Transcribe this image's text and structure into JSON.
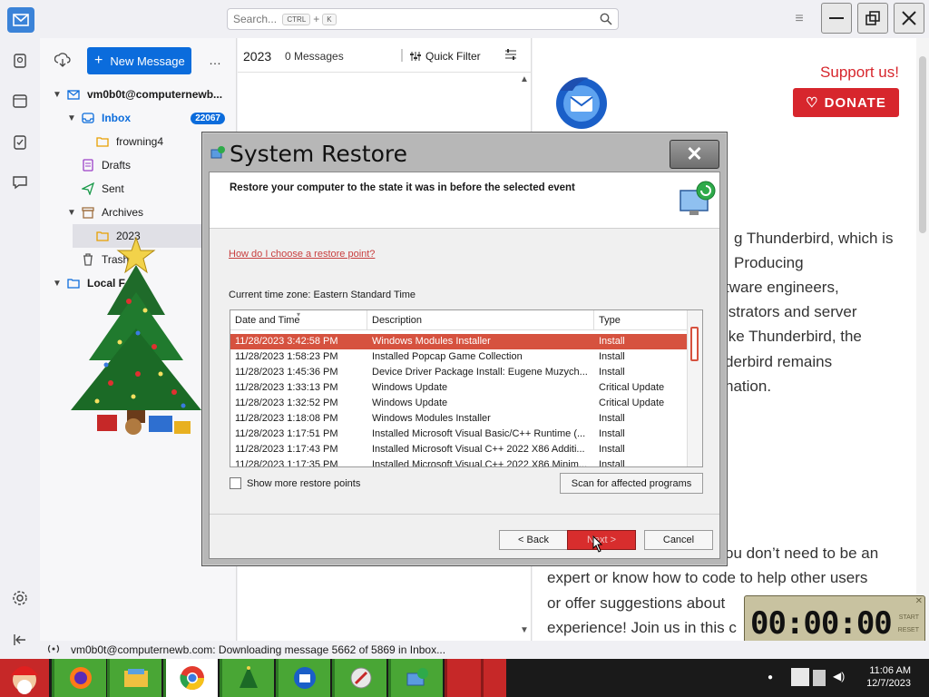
{
  "search": {
    "placeholder": "Search...",
    "key1": "CTRL",
    "plus": "+",
    "key2": "K"
  },
  "folderpane": {
    "new_message": "New Message",
    "more": "…",
    "account": "vm0b0t@computernewb...",
    "inbox": "Inbox",
    "inbox_count": "22067",
    "frowning4": "frowning4",
    "drafts": "Drafts",
    "sent": "Sent",
    "archives": "Archives",
    "archive_2023": "2023",
    "trash": "Trash",
    "local_folders": "Local F"
  },
  "msglist": {
    "folder": "2023",
    "count": "0 Messages",
    "quick_filter": "Quick Filter"
  },
  "readpane": {
    "support": "Support us!",
    "donate": "DONATE",
    "lines": [
      "g Thunderbird, which is",
      "Producing",
      "tware engineers,",
      "istrators and server",
      "ike Thunderbird, the",
      "derbird remains",
      "nation."
    ],
    "lines2": [
      "ou don’t need to be an",
      "expert or know how to code to help other users",
      "or offer suggestions about",
      "experience! Join us in this c"
    ]
  },
  "status": {
    "text": "vm0b0t@computernewb.com: Downloading message 5662 of 5869 in Inbox..."
  },
  "timer": {
    "value": "00:00:00",
    "start": "START",
    "reset": "RESET"
  },
  "clock": {
    "time": "11:06 AM",
    "date": "12/7/2023"
  },
  "dialog": {
    "title": "System Restore",
    "close": "✕",
    "header": "Restore your computer to the state it was in before the selected event",
    "link": "How do I choose a restore point?",
    "timezone": "Current time zone: Eastern Standard Time",
    "columns": [
      "Date and Time",
      "Description",
      "Type"
    ],
    "rows": [
      [
        "11/28/2023 3:42:58 PM",
        "Windows Modules Installer",
        "Install"
      ],
      [
        "11/28/2023 1:58:23 PM",
        "Installed Popcap Game Collection",
        "Install"
      ],
      [
        "11/28/2023 1:45:36 PM",
        "Device Driver Package Install: Eugene Muzych...",
        "Install"
      ],
      [
        "11/28/2023 1:33:13 PM",
        "Windows Update",
        "Critical Update"
      ],
      [
        "11/28/2023 1:32:52 PM",
        "Windows Update",
        "Critical Update"
      ],
      [
        "11/28/2023 1:18:08 PM",
        "Windows Modules Installer",
        "Install"
      ],
      [
        "11/28/2023 1:17:51 PM",
        "Installed Microsoft Visual Basic/C++ Runtime (...",
        "Install"
      ],
      [
        "11/28/2023 1:17:43 PM",
        "Installed Microsoft Visual C++ 2022 X86 Additi...",
        "Install"
      ],
      [
        "11/28/2023 1:17:35 PM",
        "Installed Microsoft Visual C++ 2022 X86 Minim...",
        "Install"
      ]
    ],
    "show_more": "Show more restore points",
    "scan": "Scan for affected programs",
    "back": "< Back",
    "next": "Next >",
    "cancel": "Cancel"
  },
  "colors": {
    "accent": "#0b6cdc",
    "donate": "#d7262d",
    "selection": "#d6523f",
    "taskbar_item": "#49a635"
  }
}
